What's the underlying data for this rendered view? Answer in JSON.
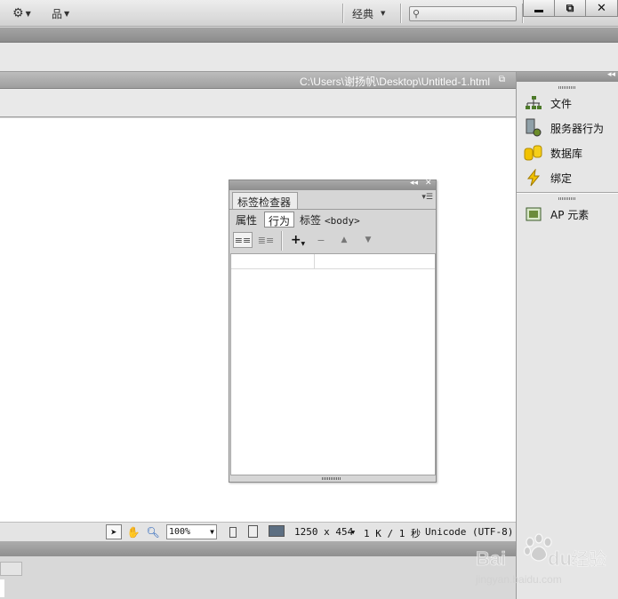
{
  "app": {
    "workspace_label": "经典",
    "search_placeholder": ""
  },
  "window_controls": {
    "minimize": "minimize",
    "restore": "restore",
    "close": "close"
  },
  "document": {
    "path": "C:\\Users\\谢扬帆\\Desktop\\Untitled-1.html"
  },
  "statusbar": {
    "zoom": "100%",
    "dimensions": "1250 x 454",
    "size_time": "1 K / 1 秒",
    "encoding": "Unicode (UTF-8)"
  },
  "right_panel": {
    "items": [
      {
        "label": "文件",
        "icon": "files-icon"
      },
      {
        "label": "服务器行为",
        "icon": "server-behaviors-icon"
      },
      {
        "label": "数据库",
        "icon": "database-icon"
      },
      {
        "label": "绑定",
        "icon": "bindings-icon"
      }
    ],
    "ap_item": {
      "label": "AP 元素",
      "icon": "ap-elements-icon"
    }
  },
  "inspector": {
    "tab_label": "标签检查器",
    "attributes_button": "属性",
    "behaviors_button": "行为",
    "tag_label": "标签",
    "tag_name": "<body>"
  },
  "colors": {
    "accent_yellow": "#f2c200",
    "files_green": "#4d7a2a"
  }
}
